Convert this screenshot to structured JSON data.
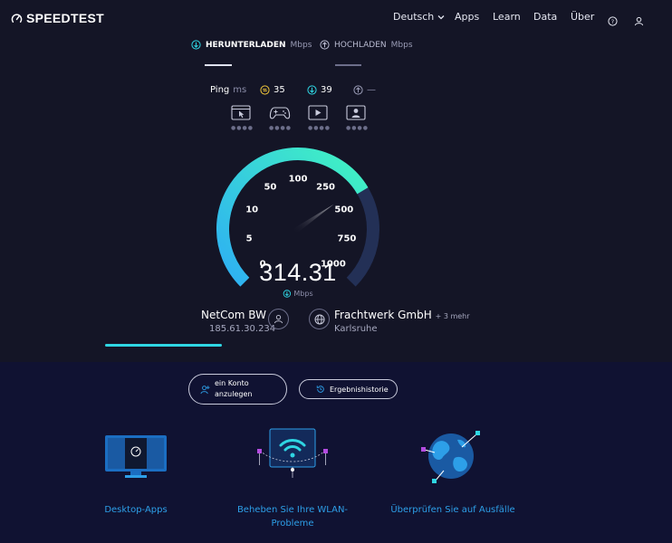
{
  "header": {
    "logo_text": "SPEEDTEST",
    "nav": {
      "language": "Deutsch",
      "apps": "Apps",
      "learn": "Learn",
      "data": "Data",
      "about": "Über"
    }
  },
  "tabs": {
    "download": {
      "label": "HERUNTERLADEN",
      "unit": "Mbps"
    },
    "upload": {
      "label": "HOCHLADEN",
      "unit": "Mbps"
    }
  },
  "ping": {
    "label": "Ping",
    "unit": "ms",
    "idle": "35",
    "download": "39",
    "upload": "—"
  },
  "gauge": {
    "ticks": [
      "0",
      "5",
      "10",
      "50",
      "100",
      "250",
      "500",
      "750",
      "1000"
    ],
    "value": "314.31",
    "unit": "Mbps",
    "arc_fill_fraction": 0.72
  },
  "provider": {
    "isp_name": "NetCom BW",
    "ip": "185.61.30.234",
    "server_name": "Frachtwerk GmbH",
    "server_more": "+ 3 mehr",
    "server_location": "Karlsruhe"
  },
  "actions": {
    "create_account": "ein Konto anzulegen",
    "create_account_line1": "ein Konto",
    "create_account_line2": "anzulegen",
    "history": "Ergebnishistorie"
  },
  "features": [
    {
      "label_line1": "Desktop-Apps",
      "label_line2": ""
    },
    {
      "label_line1": "Beheben Sie Ihre WLAN-",
      "label_line2": "Probleme"
    },
    {
      "label_line1": "Überprüfen Sie auf Ausfälle",
      "label_line2": ""
    }
  ],
  "colors": {
    "background": "#141526",
    "lower_background": "#101232",
    "gauge_start": "#2fb4f0",
    "gauge_end": "#40f0c4",
    "gauge_track": "#233056",
    "link": "#2d9fe8"
  }
}
